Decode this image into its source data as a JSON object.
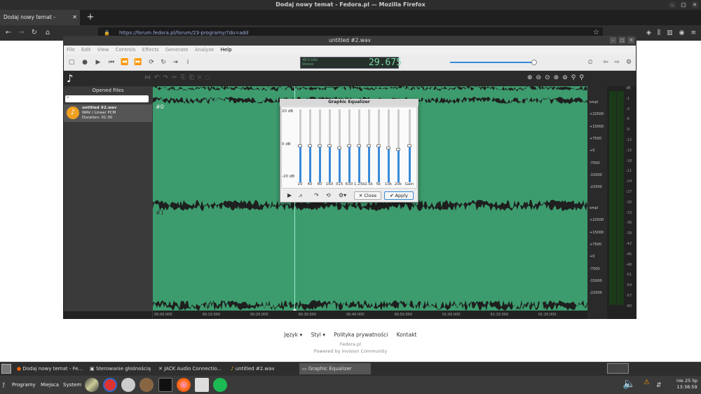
{
  "firefox": {
    "window_title": "Dodaj nowy temat - Fedora.pl — Mozilla Firefox",
    "tab_title": "Dodaj nowy temat - Fedora.pl",
    "url": "https://forum.fedora.pl/forum/23-programy/?do=add"
  },
  "page_footer": {
    "links": [
      "Język ▾",
      "Styl ▾",
      "Polityka prywatności",
      "Kontakt"
    ],
    "site": "Fedora.pl",
    "powered": "Powered by Invision Community"
  },
  "editor": {
    "title": "untitled #2.wav",
    "menu": [
      "File",
      "Edit",
      "View",
      "Controls",
      "Effects",
      "Generate",
      "Analyze",
      "Help"
    ],
    "lcd_rate": "48.0 kHz",
    "lcd_channels": "Stereo",
    "lcd_time": "29.675",
    "volume": 0.9,
    "sidebar_heading": "Opened Files",
    "file": {
      "name": "untitled #2.wav",
      "format": "WAV / Linear PCM",
      "duration": "Duration: 01:30"
    },
    "track_labels": [
      "#0",
      "#1"
    ],
    "ruler_ticks": [
      "00:00.000",
      "00:10.000",
      "00:20.000",
      "00:30.000",
      "00:40.000",
      "00:50.000",
      "01:00.000",
      "01:10.000",
      "01:20.000"
    ],
    "y_axis": [
      "smpl",
      "+22500",
      "+15000",
      "+7500",
      "+0",
      "-7500",
      "-15000",
      "-22500"
    ],
    "vu_labels": [
      "dB",
      "-1",
      "-3",
      "-6",
      "-9",
      "-12",
      "-15",
      "-18",
      "-21",
      "-24",
      "-27",
      "-30",
      "-33",
      "-36",
      "-39",
      "-42",
      "-45",
      "-48",
      "-51",
      "-54",
      "-57",
      "-60"
    ],
    "waveform_color": "#3d9c6e"
  },
  "equalizer": {
    "title": "Graphic Equalizer",
    "db_labels": [
      "20 dB",
      "0 dB",
      "-20 dB"
    ],
    "bands": [
      {
        "label": "20",
        "value": 0
      },
      {
        "label": "40",
        "value": 0
      },
      {
        "label": "80",
        "value": 0
      },
      {
        "label": "160",
        "value": 0
      },
      {
        "label": "315",
        "value": -1
      },
      {
        "label": "630",
        "value": 0
      },
      {
        "label": "1.25k",
        "value": 0
      },
      {
        "label": "2.5k",
        "value": 0
      },
      {
        "label": "5k",
        "value": 0
      },
      {
        "label": "10k",
        "value": -1
      },
      {
        "label": "20k",
        "value": -2
      },
      {
        "label": "Gain",
        "value": 0
      }
    ],
    "close_label": "Close",
    "apply_label": "Apply"
  },
  "taskbar": {
    "tasks": [
      "Dodaj nowy temat - Fe...",
      "Sterowanie głośnością",
      "JACK Audio Connectio...",
      "untitled #2.wav",
      "Graphic Equalizer"
    ],
    "active_index": 4
  },
  "panel": {
    "menus": [
      "Programy",
      "Miejsca",
      "System"
    ],
    "clock_date": "nie 25 lip",
    "clock_time": "13:38:59"
  }
}
